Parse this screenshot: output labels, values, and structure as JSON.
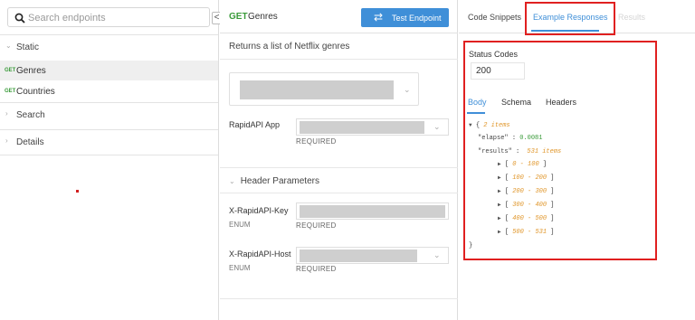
{
  "sidebar": {
    "search_placeholder": "Search endpoints",
    "collapse_glyph": "<",
    "groups": [
      {
        "label": "Static",
        "chevron": "⌄"
      },
      {
        "label": "Search",
        "chevron": "›"
      },
      {
        "label": "Details",
        "chevron": "›"
      }
    ],
    "items": [
      {
        "method": "GET",
        "label": "Genres"
      },
      {
        "method": "GET",
        "label": "Countries"
      }
    ]
  },
  "endpoint": {
    "method": "GET",
    "name": "Genres",
    "test_button": "Test Endpoint",
    "description": "Returns a list of Netflix genres"
  },
  "params": {
    "rapidapi_app": {
      "label": "RapidAPI App",
      "required": "REQUIRED"
    },
    "header_section": "Header Parameters",
    "key": {
      "label": "X-RapidAPI-Key",
      "type": "ENUM",
      "required": "REQUIRED"
    },
    "host": {
      "label": "X-RapidAPI-Host",
      "type": "ENUM",
      "required": "REQUIRED"
    }
  },
  "right": {
    "tabs": [
      "Code Snippets",
      "Example Responses",
      "Results"
    ],
    "status_label": "Status Codes",
    "status_value": "200",
    "body_tabs": [
      "Body",
      "Schema",
      "Headers"
    ],
    "json": {
      "root_meta": "2 items",
      "elapse_key": "\"elapse\"",
      "elapse_val": "0.0081",
      "results_key": "\"results\"",
      "results_meta": "531 items",
      "ranges": [
        "0 - 100",
        "100 - 200",
        "200 - 300",
        "300 - 400",
        "400 - 500",
        "500 - 531"
      ]
    }
  },
  "colors": {
    "accent": "#3f8fd8",
    "get": "#3a9b3a",
    "highlight": "#e02020"
  }
}
